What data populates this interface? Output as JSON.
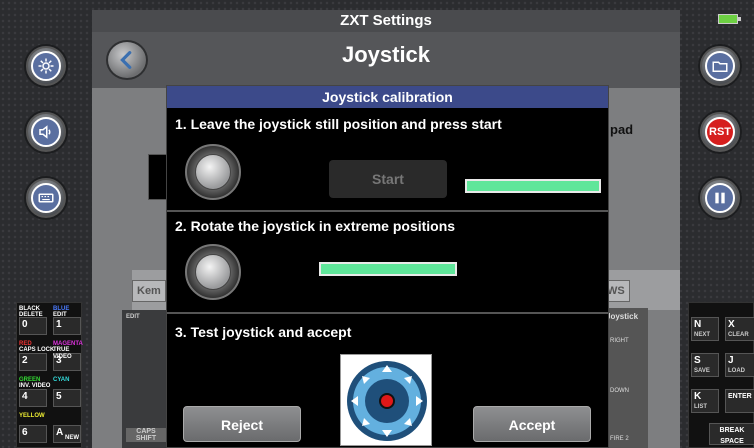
{
  "app_title": "ZXT Settings",
  "page_title": "Joystick",
  "background": {
    "pad_text": "pad",
    "kem_text": "Kem",
    "ws_text": "WS",
    "joystick_label": "Joystick",
    "caps_shift": "CAPS SHIFT",
    "edit": "EDIT",
    "right": "RIGHT",
    "down": "DOWN",
    "fire": "FIRE 2"
  },
  "dialog": {
    "title": "Joystick calibration",
    "step1": "1. Leave the joystick still position and press start",
    "start_label": "Start",
    "step2": "2. Rotate the joystick in extreme positions",
    "step3": "3. Test joystick and accept",
    "reject_label": "Reject",
    "accept_label": "Accept",
    "step1_progress": 1.0,
    "step2_progress": 1.0
  },
  "right_buttons": {
    "rst_label": "RST"
  },
  "left_keys": [
    {
      "top": "BLACK",
      "main": "0",
      "sub": "DELETE"
    },
    {
      "top": "BLUE",
      "main": "1",
      "sub": "EDIT"
    },
    {
      "top": "RED",
      "main": "2",
      "sub": "CAPS LOCK"
    },
    {
      "top": "MAGENTA",
      "main": "3",
      "sub": "TRUE VIDEO"
    },
    {
      "top": "GREEN",
      "main": "4",
      "sub": "INV. VIDEO"
    },
    {
      "top": "CYAN",
      "main": "5",
      "sub": ""
    },
    {
      "top": "YELLOW",
      "main": "6",
      "sub": ""
    },
    {
      "top": "",
      "main": "A",
      "sub": "NEW"
    }
  ],
  "right_keys": [
    {
      "main": "N",
      "sub": "NEXT"
    },
    {
      "main": "X",
      "sub": "CLEAR"
    },
    {
      "main": "S",
      "sub": "SAVE"
    },
    {
      "main": "J",
      "sub": "LOAD"
    },
    {
      "main": "K",
      "sub": "LIST"
    },
    {
      "main": "ENTER",
      "sub": ""
    },
    {
      "main": "BREAK SPACE",
      "sub": ""
    }
  ],
  "colors": {
    "accent": "#3c4a8a",
    "progress": "#5fe69a",
    "rst": "#d61e1e"
  }
}
